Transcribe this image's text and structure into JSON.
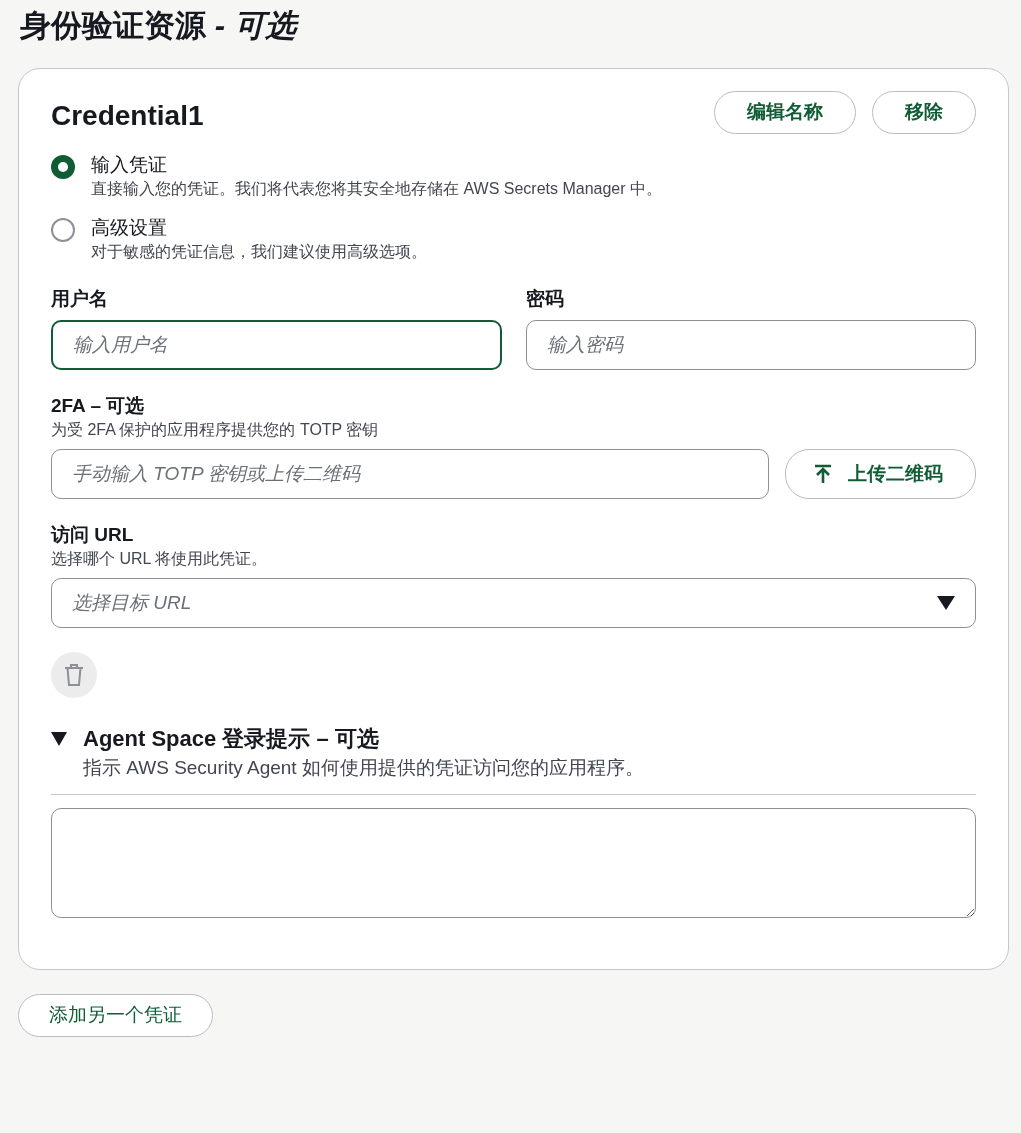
{
  "title": "身份验证资源 *- 可选*",
  "credential": {
    "name": "Credential1",
    "actions": [
      "编辑名称",
      "移除"
    ],
    "options": [
      {
        "label": "输入凭证",
        "description": "直接输入您的凭证。我们将代表您将其安全地存储在 AWS Secrets Manager 中。",
        "selected": true
      },
      {
        "label": "高级设置",
        "description": "对于敏感的凭证信息，我们建议使用高级选项。",
        "selected": false
      }
    ],
    "fields": [
      {
        "label": "用户名",
        "placeholder": "输入用户名",
        "focused": true
      },
      {
        "label": "密码",
        "placeholder": "输入密码",
        "focused": false
      }
    ],
    "twofa": {
      "label": "2FA – 可选",
      "description": "为受 2FA 保护的应用程序提供您的 TOTP 密钥",
      "placeholder": "手动输入 TOTP 密钥或上传二维码",
      "button": "上传二维码"
    },
    "access_url": {
      "label": "访问 URL",
      "description": "选择哪个 URL 将使用此凭证。",
      "placeholder": "选择目标 URL"
    },
    "hint": {
      "title": "Agent Space 登录提示 – 可选",
      "description": "指示 AWS Security Agent 如何使用提供的凭证访问您的应用程序。",
      "expanded": true
    }
  },
  "add_button": "添加另一个凭证"
}
